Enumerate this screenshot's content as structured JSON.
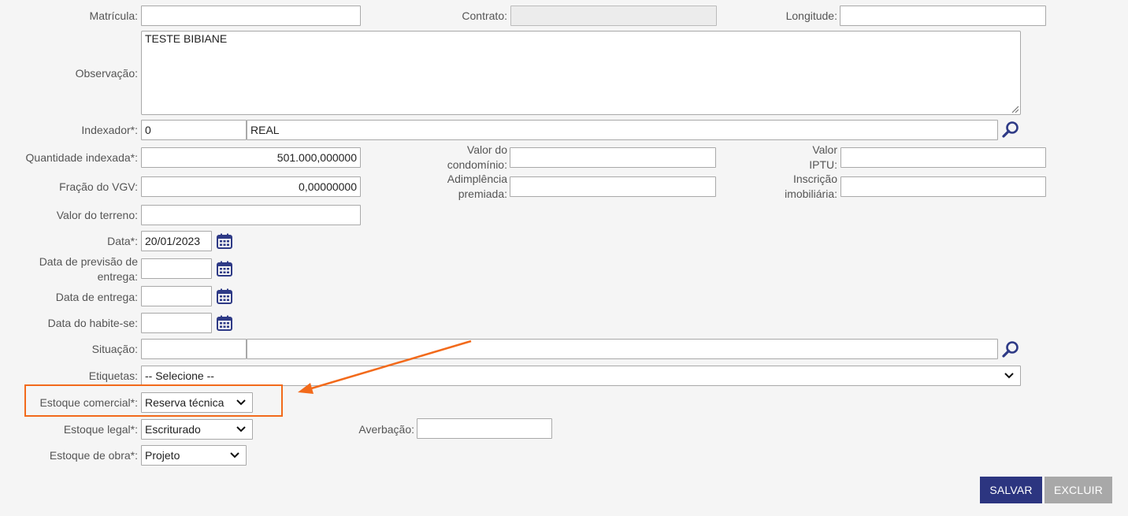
{
  "labels": {
    "matricula": "Matrícula:",
    "contrato": "Contrato:",
    "longitude": "Longitude:",
    "observacao": "Observação:",
    "indexador": "Indexador*:",
    "quantidade": "Quantidade indexada*:",
    "valor_condominio": "Valor do condomínio:",
    "valor_iptu": "Valor IPTU:",
    "fracao": "Fração do VGV:",
    "adimplencia": "Adimplência premiada:",
    "inscricao": "Inscrição imobiliária:",
    "valor_terreno": "Valor do terreno:",
    "data": "Data*:",
    "data_previsao": "Data de previsão de entrega:",
    "data_entrega": "Data de entrega:",
    "data_habite": "Data do habite-se:",
    "situacao": "Situação:",
    "etiquetas": "Etiquetas:",
    "estoque_comercial": "Estoque comercial*:",
    "estoque_legal": "Estoque legal*:",
    "averbacao": "Averbação:",
    "estoque_obra": "Estoque de obra*:"
  },
  "values": {
    "matricula": "",
    "contrato": "",
    "longitude": "",
    "observacao": "TESTE BIBIANE",
    "indexador_code": "0",
    "indexador_name": "REAL",
    "quantidade": "501.000,000000",
    "valor_condominio": "",
    "valor_iptu": "",
    "fracao": "0,00000000",
    "adimplencia": "",
    "inscricao": "",
    "valor_terreno": "",
    "data": "20/01/2023",
    "data_previsao": "",
    "data_entrega": "",
    "data_habite": "",
    "situacao_code": "",
    "situacao_name": "",
    "etiquetas": "-- Selecione --",
    "estoque_comercial": "Reserva técnica",
    "estoque_legal": "Escriturado",
    "averbacao": "",
    "estoque_obra": "Projeto"
  },
  "buttons": {
    "salvar": "SALVAR",
    "excluir": "EXCLUIR"
  },
  "icons": {
    "search": "search-icon",
    "calendar": "calendar-icon",
    "chevron": "chevron-down-icon",
    "arrow": "annotation-arrow"
  },
  "colors": {
    "primary": "#2c3580",
    "disabled_button": "#a8a8a8",
    "annotation": "#f26a1b",
    "icon": "#2e3a86"
  }
}
